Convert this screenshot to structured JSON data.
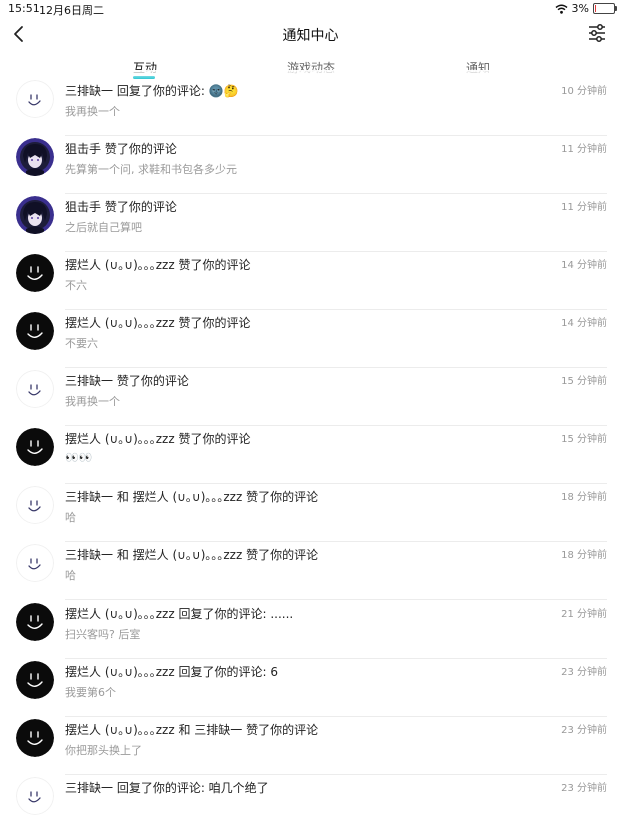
{
  "status_bar": {
    "time": "15:51",
    "date": "12月6日周二",
    "battery": "3%",
    "battery_level": 0.03
  },
  "nav": {
    "title": "通知中心"
  },
  "tabs": [
    {
      "label": "互动",
      "active": true
    },
    {
      "label": "游戏动态"
    },
    {
      "label": "通知"
    }
  ],
  "colors": {
    "accent": "#18c2cf",
    "battery_low": "#e23b3b"
  },
  "items": [
    {
      "avatar": "smile-light",
      "title": "三排缺一 回复了你的评论: 🌚🤔",
      "sub": "我再换一个",
      "time": "10 分钟前"
    },
    {
      "avatar": "anime",
      "title": "狙击手 赞了你的评论",
      "sub": "先算第一个问, 求鞋和书包各多少元",
      "time": "11 分钟前"
    },
    {
      "avatar": "anime",
      "title": "狙击手 赞了你的评论",
      "sub": "之后就自己算吧",
      "time": "11 分钟前"
    },
    {
      "avatar": "smile-dark",
      "title": "摆烂人 (∪｡∪)｡｡｡zzz 赞了你的评论",
      "sub": "不六",
      "time": "14 分钟前"
    },
    {
      "avatar": "smile-dark",
      "title": "摆烂人 (∪｡∪)｡｡｡zzz 赞了你的评论",
      "sub": "不要六",
      "time": "14 分钟前"
    },
    {
      "avatar": "smile-light",
      "title": "三排缺一 赞了你的评论",
      "sub": "我再换一个",
      "time": "15 分钟前"
    },
    {
      "avatar": "smile-dark",
      "title": "摆烂人 (∪｡∪)｡｡｡zzz 赞了你的评论",
      "sub": "👀👀",
      "time": "15 分钟前"
    },
    {
      "avatar": "smile-light",
      "title": "三排缺一 和 摆烂人 (∪｡∪)｡｡｡zzz 赞了你的评论",
      "sub": "哈",
      "time": "18 分钟前"
    },
    {
      "avatar": "smile-light",
      "title": "三排缺一 和 摆烂人 (∪｡∪)｡｡｡zzz 赞了你的评论",
      "sub": "哈",
      "time": "18 分钟前"
    },
    {
      "avatar": "smile-dark",
      "title": "摆烂人 (∪｡∪)｡｡｡zzz 回复了你的评论: ......",
      "sub": "扫兴客吗? 后室",
      "time": "21 分钟前"
    },
    {
      "avatar": "smile-dark",
      "title": "摆烂人 (∪｡∪)｡｡｡zzz 回复了你的评论: 6",
      "sub": "我要第6个",
      "time": "23 分钟前"
    },
    {
      "avatar": "smile-dark",
      "title": "摆烂人 (∪｡∪)｡｡｡zzz 和 三排缺一 赞了你的评论",
      "sub": "你把那头换上了",
      "time": "23 分钟前"
    },
    {
      "avatar": "smile-light",
      "title": "三排缺一 回复了你的评论: 咱几个绝了",
      "sub": "",
      "time": "23 分钟前"
    }
  ]
}
